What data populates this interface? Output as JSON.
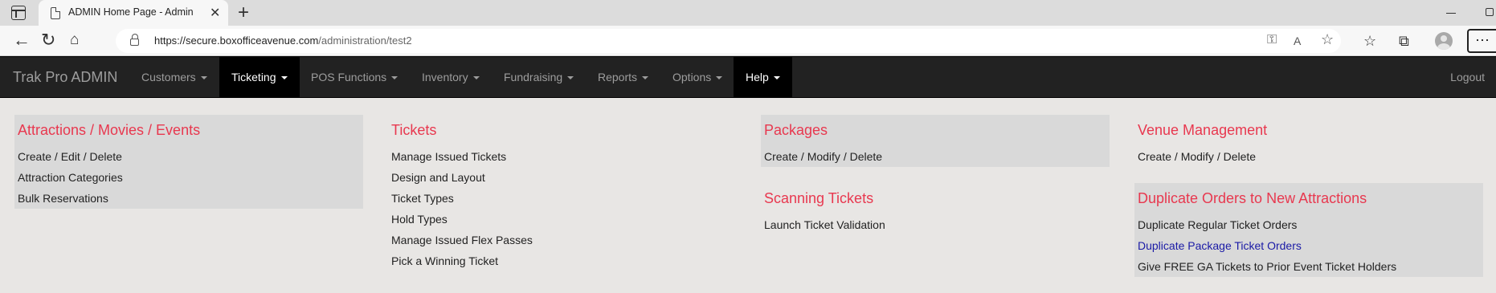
{
  "browser": {
    "tab_title": "ADMIN Home Page - Admin",
    "tab_close": "✕",
    "new_tab": "+",
    "url_host": "https://secure.boxofficeavenue.com",
    "url_path": "/administration/test2"
  },
  "navbar": {
    "brand": "Trak Pro ADMIN",
    "items": [
      {
        "label": "Customers",
        "active": false
      },
      {
        "label": "Ticketing",
        "active": true
      },
      {
        "label": "POS Functions",
        "active": false
      },
      {
        "label": "Inventory",
        "active": false
      },
      {
        "label": "Fundraising",
        "active": false
      },
      {
        "label": "Reports",
        "active": false
      },
      {
        "label": "Options",
        "active": false
      },
      {
        "label": "Help",
        "active": true
      }
    ],
    "logout": "Logout"
  },
  "menu": {
    "attractions": {
      "heading": "Attractions / Movies / Events",
      "links": [
        "Create / Edit / Delete",
        "Attraction Categories",
        "Bulk Reservations"
      ]
    },
    "tickets": {
      "heading": "Tickets",
      "links": [
        "Manage Issued Tickets",
        "Design and Layout",
        "Ticket Types",
        "Hold Types",
        "Manage Issued Flex Passes",
        "Pick a Winning Ticket"
      ]
    },
    "packages": {
      "heading": "Packages",
      "links": [
        "Create / Modify / Delete"
      ]
    },
    "scanning": {
      "heading": "Scanning Tickets",
      "links": [
        "Launch Ticket Validation"
      ]
    },
    "venue": {
      "heading": "Venue Management",
      "links": [
        "Create / Modify / Delete"
      ]
    },
    "duplicate": {
      "heading": "Duplicate Orders to New Attractions",
      "links": [
        "Duplicate Regular Ticket Orders",
        "Duplicate Package Ticket Orders",
        "Give FREE GA Tickets to Prior Event Ticket Holders"
      ]
    }
  },
  "colors": {
    "heading_red": "#e8384f",
    "navbar_bg": "#222222",
    "link_hover_blue": "#1a1aa6"
  }
}
